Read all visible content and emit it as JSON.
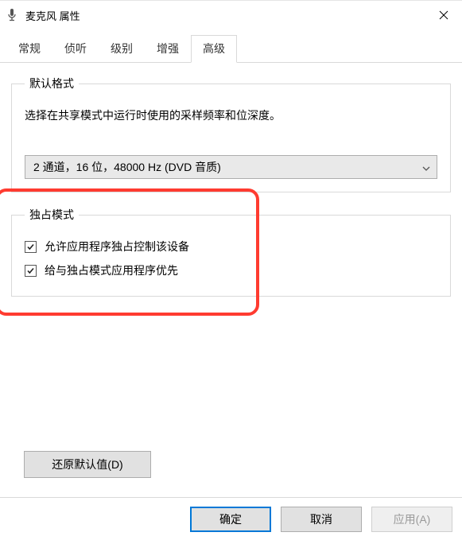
{
  "window": {
    "title": "麦克风 属性"
  },
  "tabs": {
    "general": "常规",
    "listen": "侦听",
    "levels": "级别",
    "enhance": "增强",
    "advanced": "高级"
  },
  "group_default": {
    "legend": "默认格式",
    "description": "选择在共享模式中运行时使用的采样频率和位深度。",
    "selected_format": "2 通道，16 位，48000 Hz (DVD 音质)"
  },
  "group_exclusive": {
    "legend": "独占模式",
    "checkbox1": "允许应用程序独占控制该设备",
    "checkbox2": "给与独占模式应用程序优先"
  },
  "buttons": {
    "restore": "还原默认值(D)",
    "ok": "确定",
    "cancel": "取消",
    "apply": "应用(A)"
  }
}
